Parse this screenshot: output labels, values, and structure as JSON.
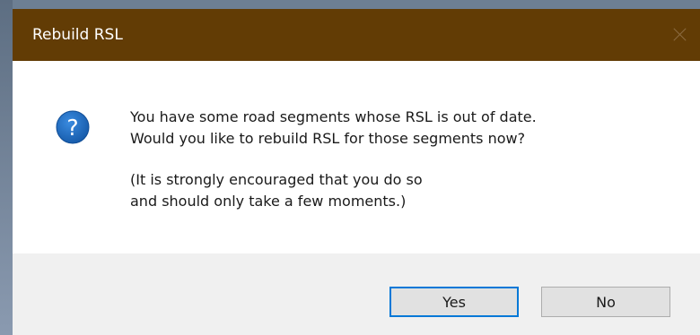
{
  "dialog": {
    "title": "Rebuild RSL",
    "icon": "question-icon",
    "message_lines": [
      "You have some road segments whose RSL is out of date.",
      "Would you like to rebuild RSL for those segments now?"
    ],
    "note_lines": [
      "(It is strongly encouraged that you do so",
      "and should only take a few moments.)"
    ],
    "buttons": {
      "yes": "Yes",
      "no": "No"
    }
  },
  "colors": {
    "title_bar": "#623c05",
    "icon_blue": "#1c6fc4",
    "default_button_border": "#0078d7",
    "footer": "#f0f0f0"
  }
}
